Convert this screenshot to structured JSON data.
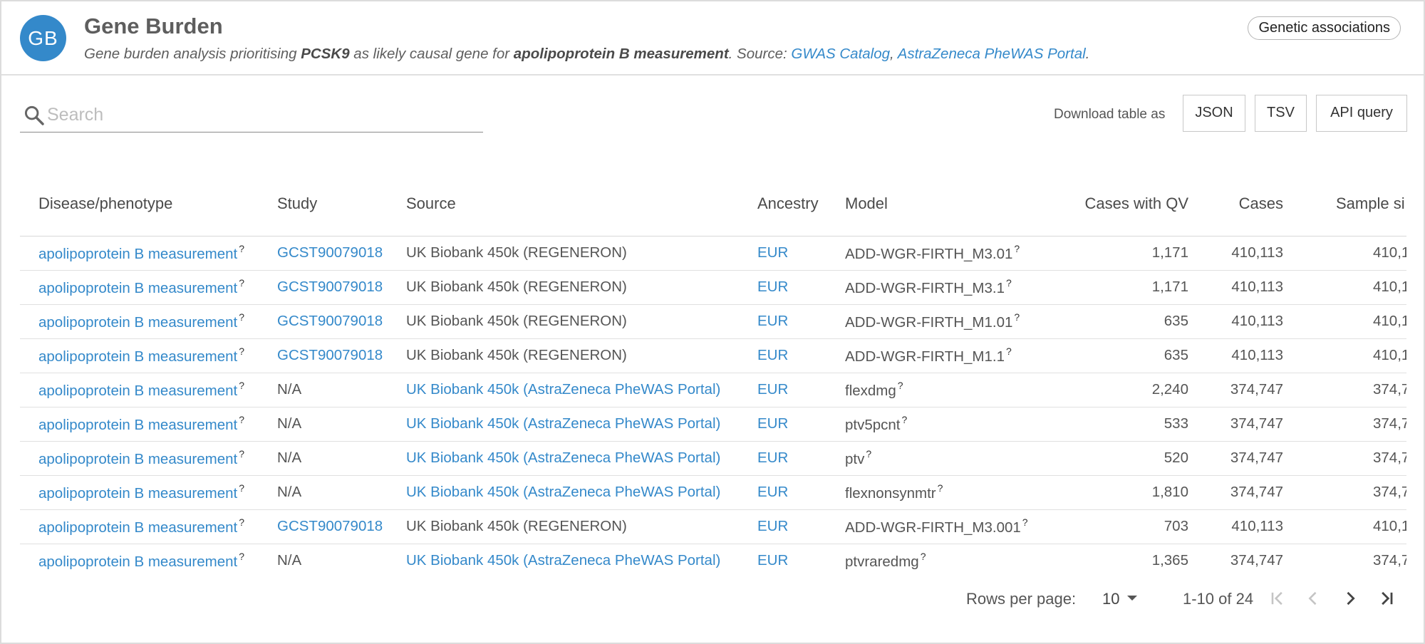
{
  "header": {
    "avatar": "GB",
    "title": "Gene Burden",
    "subtitle": {
      "p1": "Gene burden analysis prioritising ",
      "gene": "PCSK9",
      "p2": " as likely causal gene for ",
      "trait": "apolipoprotein B measurement",
      "p3": ". Source: ",
      "link1": "GWAS Catalog",
      "sep": ", ",
      "link2": "AstraZeneca PheWAS Portal",
      "end": "."
    },
    "chip": "Genetic associations"
  },
  "search": {
    "placeholder": "Search",
    "value": ""
  },
  "download": {
    "label": "Download table as",
    "json": "JSON",
    "tsv": "TSV",
    "api": "API query"
  },
  "table": {
    "columns": [
      "Disease/phenotype",
      "Study",
      "Source",
      "Ancestry",
      "Model",
      "Cases with QV",
      "Cases",
      "Sample si"
    ],
    "rows": [
      {
        "disease": "apolipoprotein B measurement",
        "study": "GCST90079018",
        "source": "UK Biobank 450k (REGENERON)",
        "ancestry": "EUR",
        "model": "ADD-WGR-FIRTH_M3.01",
        "qv": "1,171",
        "cases": "410,113",
        "sample": "410,1"
      },
      {
        "disease": "apolipoprotein B measurement",
        "study": "GCST90079018",
        "source": "UK Biobank 450k (REGENERON)",
        "ancestry": "EUR",
        "model": "ADD-WGR-FIRTH_M3.1",
        "qv": "1,171",
        "cases": "410,113",
        "sample": "410,1"
      },
      {
        "disease": "apolipoprotein B measurement",
        "study": "GCST90079018",
        "source": "UK Biobank 450k (REGENERON)",
        "ancestry": "EUR",
        "model": "ADD-WGR-FIRTH_M1.01",
        "qv": "635",
        "cases": "410,113",
        "sample": "410,1"
      },
      {
        "disease": "apolipoprotein B measurement",
        "study": "GCST90079018",
        "source": "UK Biobank 450k (REGENERON)",
        "ancestry": "EUR",
        "model": "ADD-WGR-FIRTH_M1.1",
        "qv": "635",
        "cases": "410,113",
        "sample": "410,1"
      },
      {
        "disease": "apolipoprotein B measurement",
        "study": "N/A",
        "source": "UK Biobank 450k (AstraZeneca PheWAS Portal)",
        "ancestry": "EUR",
        "model": "flexdmg",
        "qv": "2,240",
        "cases": "374,747",
        "sample": "374,7"
      },
      {
        "disease": "apolipoprotein B measurement",
        "study": "N/A",
        "source": "UK Biobank 450k (AstraZeneca PheWAS Portal)",
        "ancestry": "EUR",
        "model": "ptv5pcnt",
        "qv": "533",
        "cases": "374,747",
        "sample": "374,7"
      },
      {
        "disease": "apolipoprotein B measurement",
        "study": "N/A",
        "source": "UK Biobank 450k (AstraZeneca PheWAS Portal)",
        "ancestry": "EUR",
        "model": "ptv",
        "qv": "520",
        "cases": "374,747",
        "sample": "374,7"
      },
      {
        "disease": "apolipoprotein B measurement",
        "study": "N/A",
        "source": "UK Biobank 450k (AstraZeneca PheWAS Portal)",
        "ancestry": "EUR",
        "model": "flexnonsynmtr",
        "qv": "1,810",
        "cases": "374,747",
        "sample": "374,7"
      },
      {
        "disease": "apolipoprotein B measurement",
        "study": "GCST90079018",
        "source": "UK Biobank 450k (REGENERON)",
        "ancestry": "EUR",
        "model": "ADD-WGR-FIRTH_M3.001",
        "qv": "703",
        "cases": "410,113",
        "sample": "410,1"
      },
      {
        "disease": "apolipoprotein B measurement",
        "study": "N/A",
        "source": "UK Biobank 450k (AstraZeneca PheWAS Portal)",
        "ancestry": "EUR",
        "model": "ptvraredmg",
        "qv": "1,365",
        "cases": "374,747",
        "sample": "374,7"
      }
    ],
    "tooltip_mark": "?"
  },
  "pagination": {
    "rows_per_page_label": "Rows per page:",
    "rows_per_page_value": "10",
    "range": "1-10 of 24"
  },
  "colors": {
    "accent": "#3489ca",
    "text": "#5a5a5a",
    "border": "#dcdcdc"
  },
  "icons": [
    "search-icon",
    "first-page-icon",
    "prev-page-icon",
    "next-page-icon",
    "last-page-icon",
    "chevron-down-icon"
  ]
}
